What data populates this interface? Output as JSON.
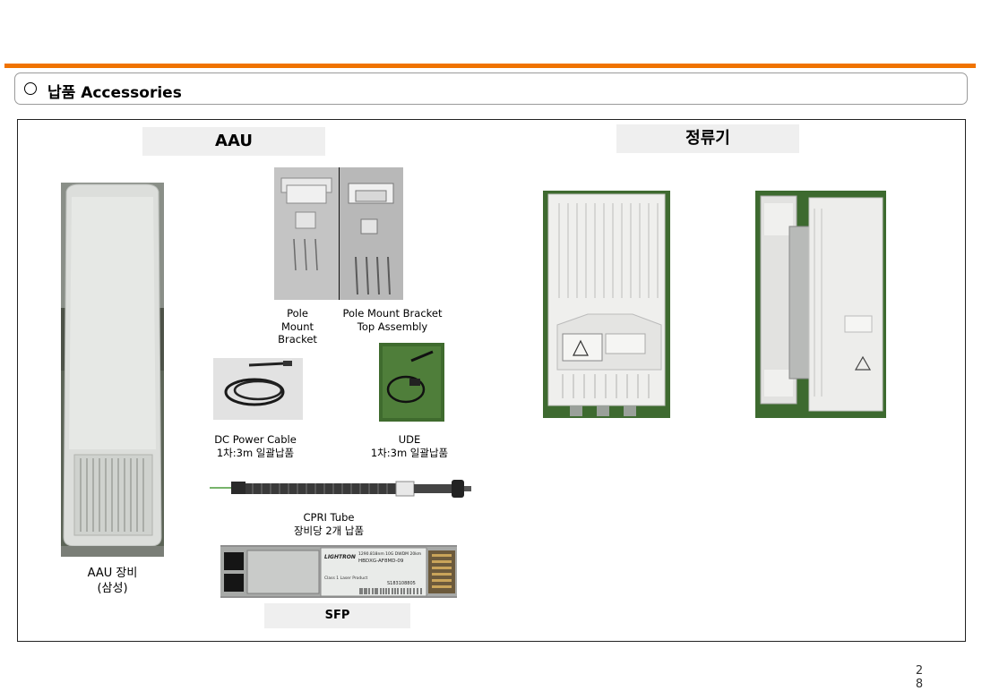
{
  "section": {
    "title": "납품 Accessories"
  },
  "headers": {
    "aau": "AAU",
    "rectifier": "정류기",
    "sfp": "SFP"
  },
  "captions": {
    "aau_equipment": [
      "AAU 장비",
      "(삼성)"
    ],
    "pole_mount_bracket": [
      "Pole",
      "Mount",
      "Bracket"
    ],
    "pole_mount_top": [
      "Pole Mount Bracket",
      "Top Assembly"
    ],
    "dc_power_cable": [
      "DC Power Cable",
      "1차:3m 일괄납품"
    ],
    "ude": [
      "UDE",
      "1차:3m 일괄납품"
    ],
    "cpri_tube": [
      "CPRI Tube",
      "장비당 2개 납품"
    ]
  },
  "sfp_label": {
    "brand": "LIGHTRON",
    "spec": "1290.818nm 10G DWDM 20km",
    "model": "HBDXG-AF8MD-09",
    "class": "Class 1 Laser Product",
    "serial": "S183108805"
  },
  "page_number": [
    "2",
    "8"
  ]
}
